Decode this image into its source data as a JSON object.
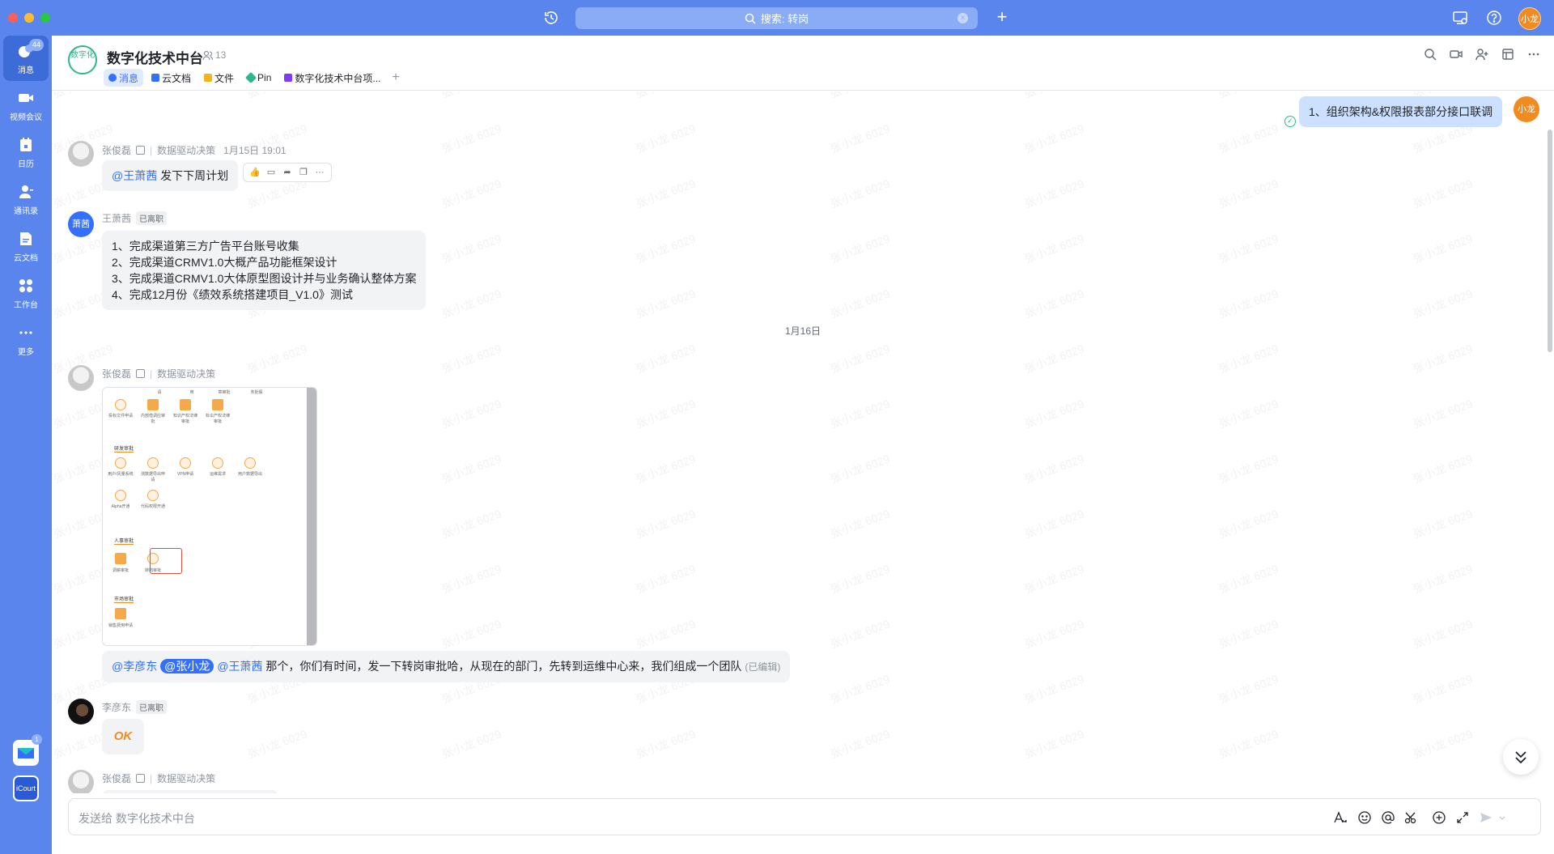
{
  "search": {
    "text": "搜索: 转岗"
  },
  "user_avatar": "小龙",
  "nav": [
    {
      "label": "消息",
      "badge": "44"
    },
    {
      "label": "视频会议"
    },
    {
      "label": "日历"
    },
    {
      "label": "通讯录"
    },
    {
      "label": "云文档"
    },
    {
      "label": "工作台"
    },
    {
      "label": "更多"
    }
  ],
  "bottom_nav": {
    "mail_badge": "1",
    "app_label": "iCourt"
  },
  "chat": {
    "group_avatar": "数字化",
    "name": "数字化技术中台",
    "member_count": "13",
    "tabs": [
      {
        "label": "消息",
        "color": "#3370ff"
      },
      {
        "label": "云文档",
        "color": "#3370ff"
      },
      {
        "label": "文件",
        "color": "#f5b31a"
      },
      {
        "label": "Pin",
        "color": "#2fb68e"
      },
      {
        "label": "数字化技术中台项...",
        "color": "#7f3bf5"
      }
    ]
  },
  "watermark": "张小龙 6029",
  "messages": {
    "self_msg": {
      "text": "1、组织架构&权限报表部分接口联调",
      "avatar": "小龙"
    },
    "m1": {
      "sender": "张俊磊",
      "dept": "数据驱动决策",
      "time": "1月15日 19:01",
      "mention": "@王萧茜",
      "text": " 发下下周计划"
    },
    "m2": {
      "sender": "王萧茜",
      "avatar": "萧茜",
      "tag": "已离职",
      "lines": [
        "1、完成渠道第三方广告平台账号收集",
        "2、完成渠道CRMV1.0大概产品功能框架设计",
        "3、完成渠道CRMV1.0大体原型图设计并与业务确认整体方案",
        "4、完成12月份《绩效系统搭建项目_V1.0》测试"
      ]
    },
    "date_sep": "1月16日",
    "m3": {
      "sender": "张俊磊",
      "dept": "数据驱动决策",
      "mention1": "@李彦东",
      "mention2": "@张小龙",
      "mention3": "@王萧茜",
      "text": " 那个，你们有时间，发一下转岗审批哈，从现在的部门，先转到运维中心来，我们组成一个团队",
      "edited": "(已编辑)"
    },
    "m4": {
      "sender": "李彦东",
      "tag": "已离职",
      "sticker": "OK"
    },
    "m5": {
      "sender": "张俊磊",
      "dept": "数据驱动决策"
    }
  },
  "screenshot_image": {
    "top_labels": [
      "请",
      "用",
      "章审批",
      "务批假"
    ],
    "row1": [
      "投标文件申请",
      "内部借调应审批",
      "知识产权法律审批",
      "标讼产权法律审批"
    ],
    "section_research": "研发审批",
    "row2": [
      "用户/风量系统",
      "测数据导出申请",
      "VPN申请",
      "运维需求",
      "用户数据导出"
    ],
    "row3": [
      "Alpha开通",
      "代码权限开通"
    ],
    "section_hr": "人事审批",
    "row4": [
      "调薪审批",
      "转岗审批"
    ],
    "section_market": "市场审批",
    "row5": [
      "销售费用申请"
    ]
  },
  "input": {
    "placeholder": "发送给 数字化技术中台"
  }
}
